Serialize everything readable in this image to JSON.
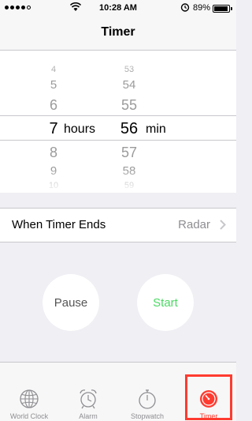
{
  "status": {
    "time": "10:28 AM",
    "battery": "89%"
  },
  "nav": {
    "title": "Timer"
  },
  "picker": {
    "hours": [
      "4",
      "5",
      "6",
      "7",
      "8",
      "9",
      "10"
    ],
    "minutes": [
      "53",
      "54",
      "55",
      "56",
      "57",
      "58",
      "59"
    ],
    "selected_hours": "7",
    "selected_minutes": "56",
    "hours_unit": "hours",
    "minutes_unit": "min"
  },
  "when_timer_ends": {
    "label": "When Timer Ends",
    "value": "Radar"
  },
  "buttons": {
    "pause": "Pause",
    "start": "Start"
  },
  "tabs": [
    {
      "label": "World Clock",
      "icon": "globe-icon"
    },
    {
      "label": "Alarm",
      "icon": "alarm-clock-icon"
    },
    {
      "label": "Stopwatch",
      "icon": "stopwatch-icon"
    },
    {
      "label": "Timer",
      "icon": "timer-icon",
      "active": true
    }
  ],
  "colors": {
    "accent": "#ff3b30",
    "start": "#4cd964",
    "background": "#efeff4"
  }
}
